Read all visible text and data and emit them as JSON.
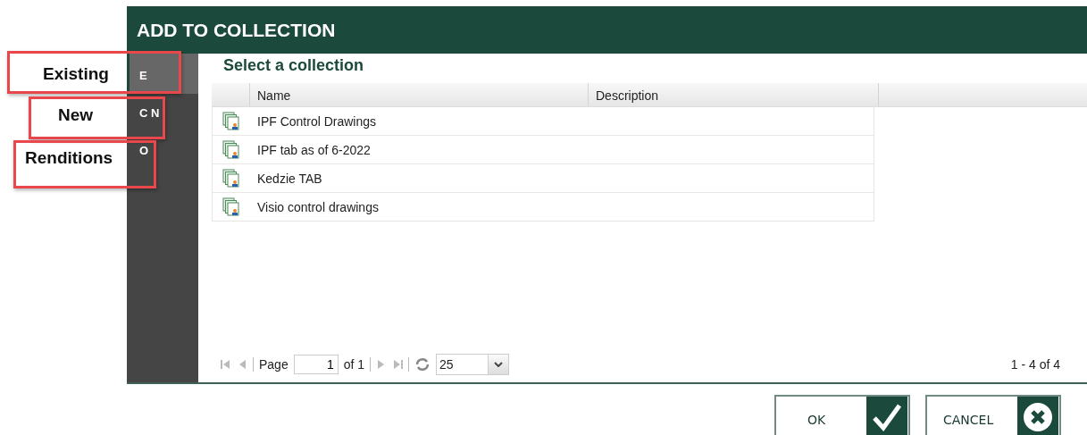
{
  "window": {
    "title": "ADD TO COLLECTION"
  },
  "callouts": [
    {
      "label": "Existing"
    },
    {
      "label": "New"
    },
    {
      "label": "Renditions"
    }
  ],
  "sidebar": {
    "items": [
      {
        "label": "E",
        "selected": true
      },
      {
        "label": "C N",
        "selected": false
      },
      {
        "label": "O",
        "selected": false
      }
    ]
  },
  "heading": "Select a collection",
  "table": {
    "columns": [
      "Name",
      "Description"
    ],
    "rows": [
      {
        "name": "IPF Control Drawings",
        "description": ""
      },
      {
        "name": "IPF tab as of 6-2022",
        "description": ""
      },
      {
        "name": "Kedzie TAB",
        "description": ""
      },
      {
        "name": "Visio control drawings",
        "description": ""
      }
    ]
  },
  "pager": {
    "page_label": "Page",
    "page": "1",
    "of": "of 1",
    "page_size": "25",
    "summary": "1 - 4 of 4",
    "first_disabled": true,
    "last_disabled": true
  },
  "buttons": [
    {
      "label": "OK",
      "kind": "ok"
    },
    {
      "label": "CANCEL",
      "kind": "cancel"
    }
  ]
}
